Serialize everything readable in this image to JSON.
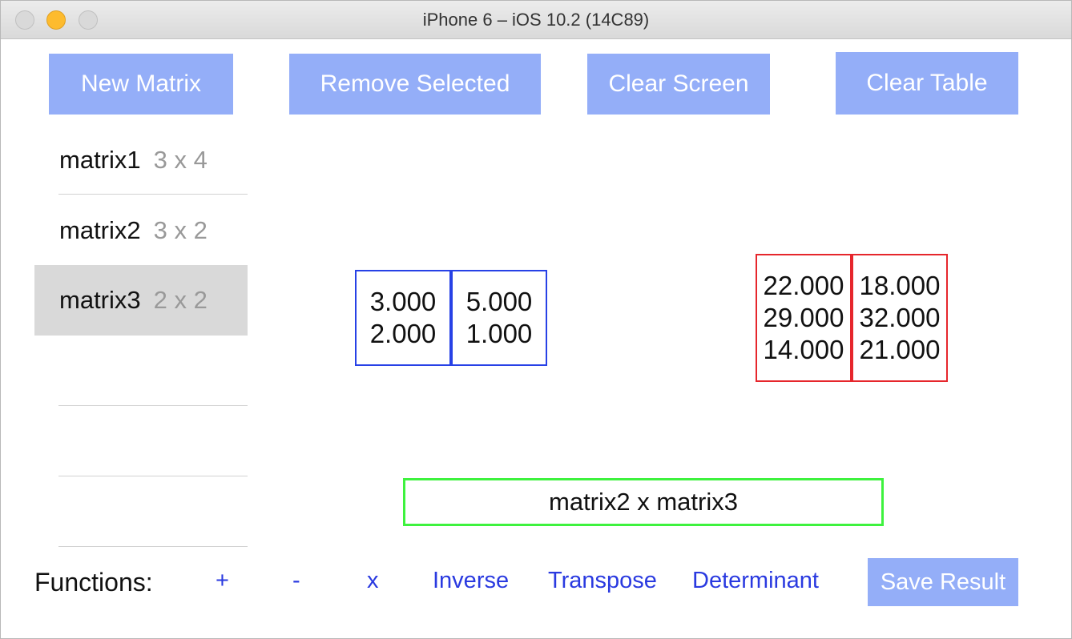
{
  "window": {
    "title": "iPhone 6 – iOS 10.2 (14C89)"
  },
  "toolbar": {
    "new_matrix": "New Matrix",
    "remove_selected": "Remove Selected",
    "clear_screen": "Clear Screen",
    "clear_table": "Clear Table"
  },
  "matrix_list": [
    {
      "name": "matrix1",
      "dims": "3 x 4",
      "selected": false
    },
    {
      "name": "matrix2",
      "dims": "3 x 2",
      "selected": false
    },
    {
      "name": "matrix3",
      "dims": "2 x 2",
      "selected": true
    }
  ],
  "display": {
    "input_matrix": {
      "columns": [
        [
          "3.000",
          "2.000"
        ],
        [
          "5.000",
          "1.000"
        ]
      ]
    },
    "result_matrix": {
      "columns": [
        [
          "22.000",
          "29.000",
          "14.000"
        ],
        [
          "18.000",
          "32.000",
          "21.000"
        ]
      ]
    },
    "expression": "matrix2 x matrix3"
  },
  "functions": {
    "label": "Functions:",
    "plus": "+",
    "minus": "-",
    "multiply": "x",
    "inverse": "Inverse",
    "transpose": "Transpose",
    "determinant": "Determinant",
    "save_result": "Save Result"
  },
  "colors": {
    "button_bg": "#94aef8",
    "input_border": "#2741e6",
    "result_border": "#e6262c",
    "expression_border": "#3ef23e",
    "function_text": "#2a3ae0",
    "selected_row": "#d9d9d9"
  }
}
